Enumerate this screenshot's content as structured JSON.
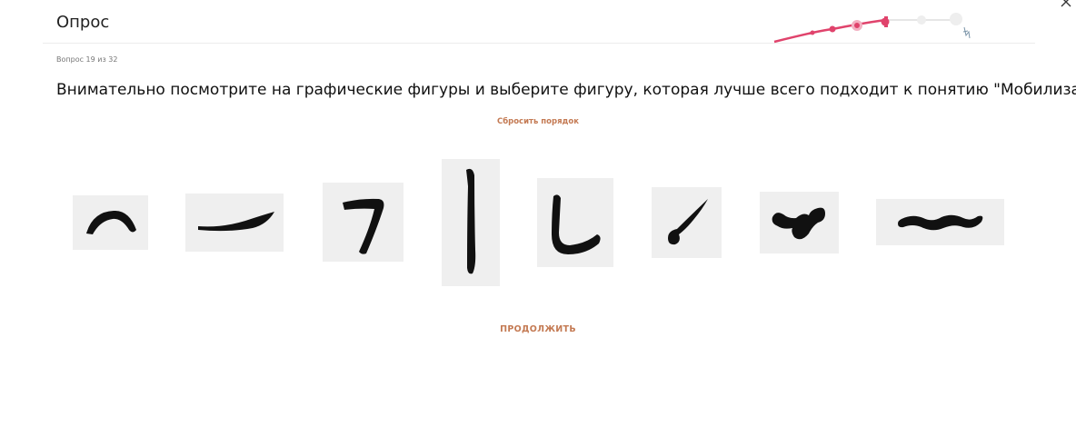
{
  "header": {
    "title": "Опрос"
  },
  "progress": {
    "current": 19,
    "total": 32
  },
  "counter_text": "Вопрос 19 из 32",
  "question": "Внимательно посмотрите на графические фигуры и выберите фигуру, которая лучше всего подходит к понятию \"Мобилизация\".",
  "reset_label": "Сбросить порядок",
  "continue_label": "ПРОДОЛЖИТЬ",
  "colors": {
    "accent": "#c47a53",
    "progress": "#e0436c",
    "tile": "#efefef"
  },
  "figures": [
    {
      "shape": "arc-hook"
    },
    {
      "shape": "horn-stroke"
    },
    {
      "shape": "seven-hook"
    },
    {
      "shape": "vertical-bar"
    },
    {
      "shape": "l-curve"
    },
    {
      "shape": "diagonal-drop"
    },
    {
      "shape": "blob-squiggle"
    },
    {
      "shape": "wave-bar"
    }
  ]
}
